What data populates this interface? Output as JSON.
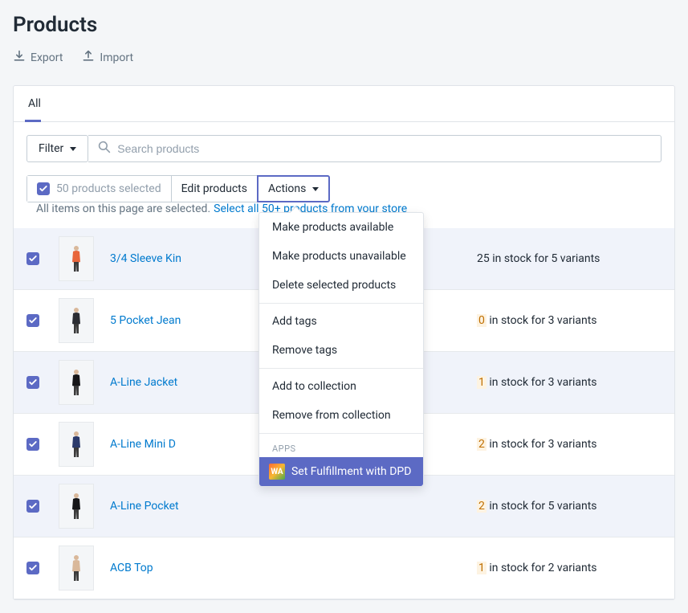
{
  "page_title": "Products",
  "toolbar": {
    "export_label": "Export",
    "import_label": "Import"
  },
  "tabs": [
    {
      "label": "All",
      "active": true
    }
  ],
  "filter": {
    "button_label": "Filter",
    "search_placeholder": "Search products"
  },
  "selection": {
    "count_label": "50 products selected",
    "edit_label": "Edit products",
    "actions_label": "Actions",
    "info_text": "All items on this page are selected.",
    "select_all_link": "Select all 50+ products from your store"
  },
  "actions_menu": {
    "groups": [
      [
        "Make products available",
        "Make products unavailable",
        "Delete selected products"
      ],
      [
        "Add tags",
        "Remove tags"
      ],
      [
        "Add to collection",
        "Remove from collection"
      ]
    ],
    "apps_header": "APPS",
    "app_item": {
      "icon_text": "WA",
      "label": "Set Fulfillment with DPD"
    }
  },
  "products": [
    {
      "name": "3/4 Sleeve Kin",
      "stock_num": "25",
      "stock_suffix": " in stock for 5 variants",
      "stock_class": "num",
      "img_fill": "#e8663c"
    },
    {
      "name": "5 Pocket Jean",
      "stock_num": "0",
      "stock_suffix": " in stock for 3 variants",
      "stock_class": "zero",
      "img_fill": "#2b2d33"
    },
    {
      "name": "A-Line Jacket",
      "stock_num": "1",
      "stock_suffix": " in stock for 3 variants",
      "stock_class": "low",
      "img_fill": "#161618"
    },
    {
      "name": "A-Line Mini D",
      "stock_num": "2",
      "stock_suffix": " in stock for 3 variants",
      "stock_class": "low",
      "img_fill": "#2b3a6b"
    },
    {
      "name": "A-Line Pocket",
      "stock_num": "2",
      "stock_suffix": " in stock for 5 variants",
      "stock_class": "low",
      "img_fill": "#161618"
    },
    {
      "name": "ACB Top",
      "stock_num": "1",
      "stock_suffix": " in stock for 2 variants",
      "stock_class": "low",
      "img_fill": "#d9b89a"
    }
  ]
}
